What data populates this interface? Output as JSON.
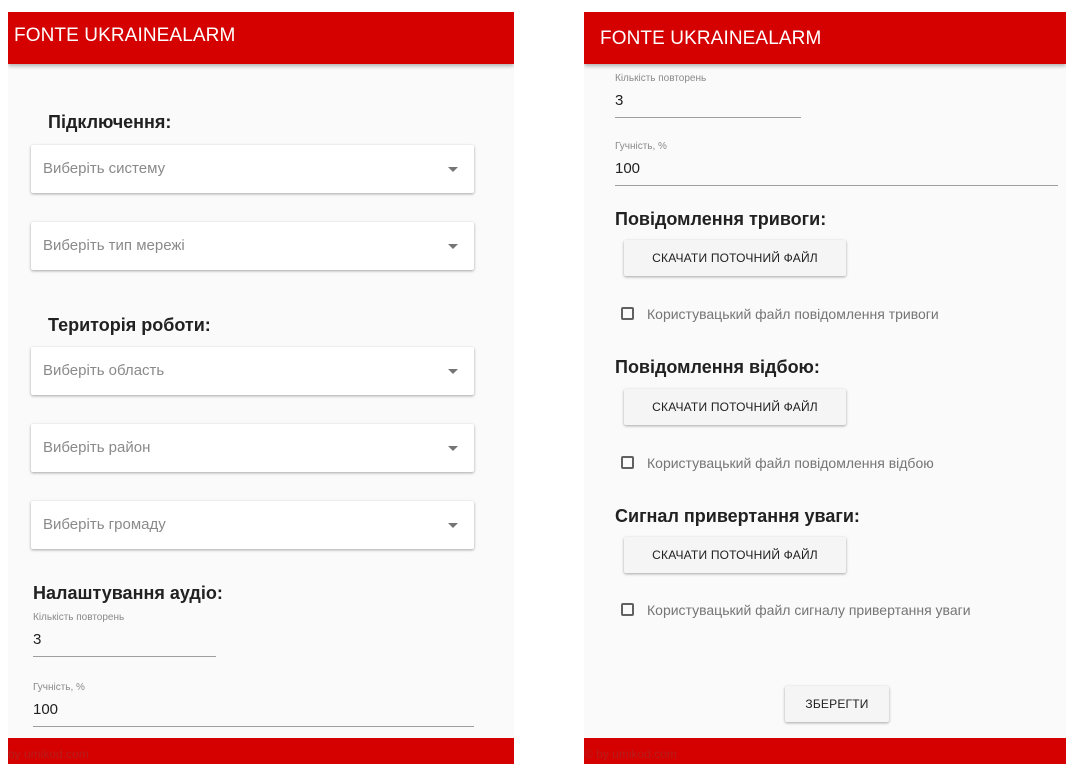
{
  "app": {
    "title": "FONTE UKRAINEALARM",
    "footer_text": "by umikod.com"
  },
  "left": {
    "connection_heading": "Підключення:",
    "system_select": {
      "placeholder": "Виберіть систему"
    },
    "network_select": {
      "placeholder": "Виберіть тип мережі"
    },
    "territory_heading": "Територія роботи:",
    "region_select": {
      "placeholder": "Виберіть область"
    },
    "district_select": {
      "placeholder": "Виберіть район"
    },
    "community_select": {
      "placeholder": "Виберіть громаду"
    },
    "audio_heading": "Налаштування аудіо:",
    "repeat_field": {
      "label": "Кількість повторень",
      "value": "3"
    },
    "volume_field": {
      "label": "Гучність, %",
      "value": "100"
    }
  },
  "right": {
    "repeat_field": {
      "label": "Кількість повторень",
      "value": "3"
    },
    "volume_field": {
      "label": "Гучність, %",
      "value": "100"
    },
    "alarm_heading": "Повідомлення тривоги:",
    "alarm_download_label": "СКАЧАТИ ПОТОЧНИЙ ФАЙЛ",
    "alarm_custom_label": "Користувацький файл повідомлення тривоги",
    "clear_heading": "Повідомлення відбою:",
    "clear_download_label": "СКАЧАТИ ПОТОЧНИЙ ФАЙЛ",
    "clear_custom_label": "Користувацький файл повідомлення відбою",
    "attention_heading": "Сигнал привертання уваги:",
    "attention_download_label": "СКАЧАТИ ПОТОЧНИЙ ФАЙЛ",
    "attention_custom_label": "Користувацький файл сигналу привертання уваги",
    "save_label": "ЗБЕРЕГТИ",
    "footer_text": "© by umikod.com"
  },
  "colors": {
    "appbar": "#d50000",
    "background": "#fafafa",
    "footer_text": "#b71c1c"
  }
}
